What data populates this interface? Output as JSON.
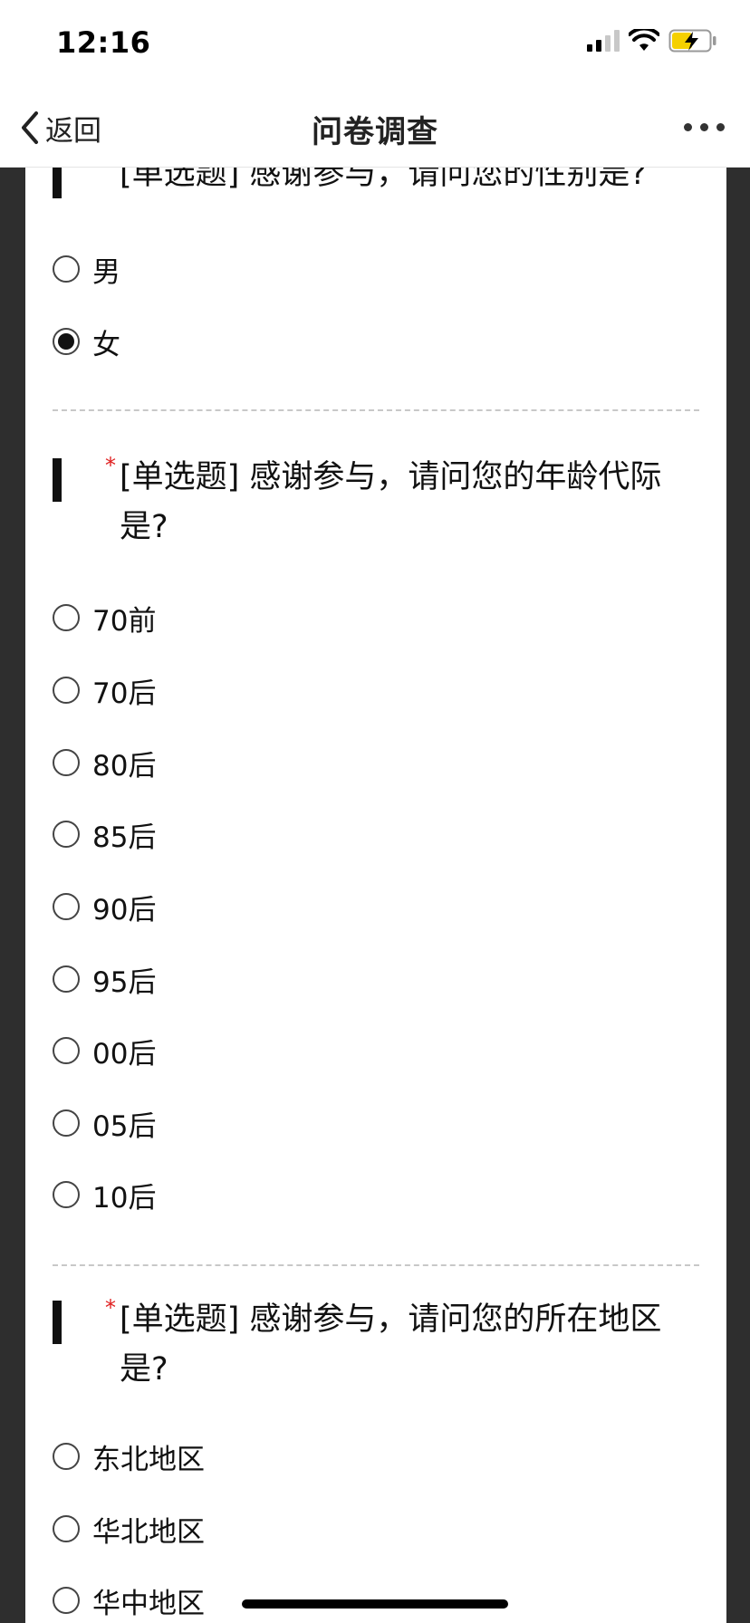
{
  "status_bar": {
    "time": "12:16"
  },
  "nav": {
    "back_label": "返回",
    "title": "问卷调查"
  },
  "questions": [
    {
      "required_mark": "*",
      "text": "[单选题] 感谢参与，请问您的性别是?",
      "options": [
        {
          "label": "男",
          "selected": false
        },
        {
          "label": "女",
          "selected": true
        }
      ]
    },
    {
      "required_mark": "*",
      "text": "[单选题] 感谢参与，请问您的年龄代际是?",
      "options": [
        {
          "label": "70前",
          "selected": false
        },
        {
          "label": "70后",
          "selected": false
        },
        {
          "label": "80后",
          "selected": false
        },
        {
          "label": "85后",
          "selected": false
        },
        {
          "label": "90后",
          "selected": false
        },
        {
          "label": "95后",
          "selected": false
        },
        {
          "label": "00后",
          "selected": false
        },
        {
          "label": "05后",
          "selected": false
        },
        {
          "label": "10后",
          "selected": false
        }
      ]
    },
    {
      "required_mark": "*",
      "text": "[单选题] 感谢参与，请问您的所在地区是?",
      "options": [
        {
          "label": "东北地区",
          "selected": false
        },
        {
          "label": "华北地区",
          "selected": false
        },
        {
          "label": "华中地区",
          "selected": false
        }
      ]
    }
  ],
  "colors": {
    "required_star": "#e02020",
    "page_bg": "#2e2e2e",
    "card_bg": "#ffffff"
  }
}
